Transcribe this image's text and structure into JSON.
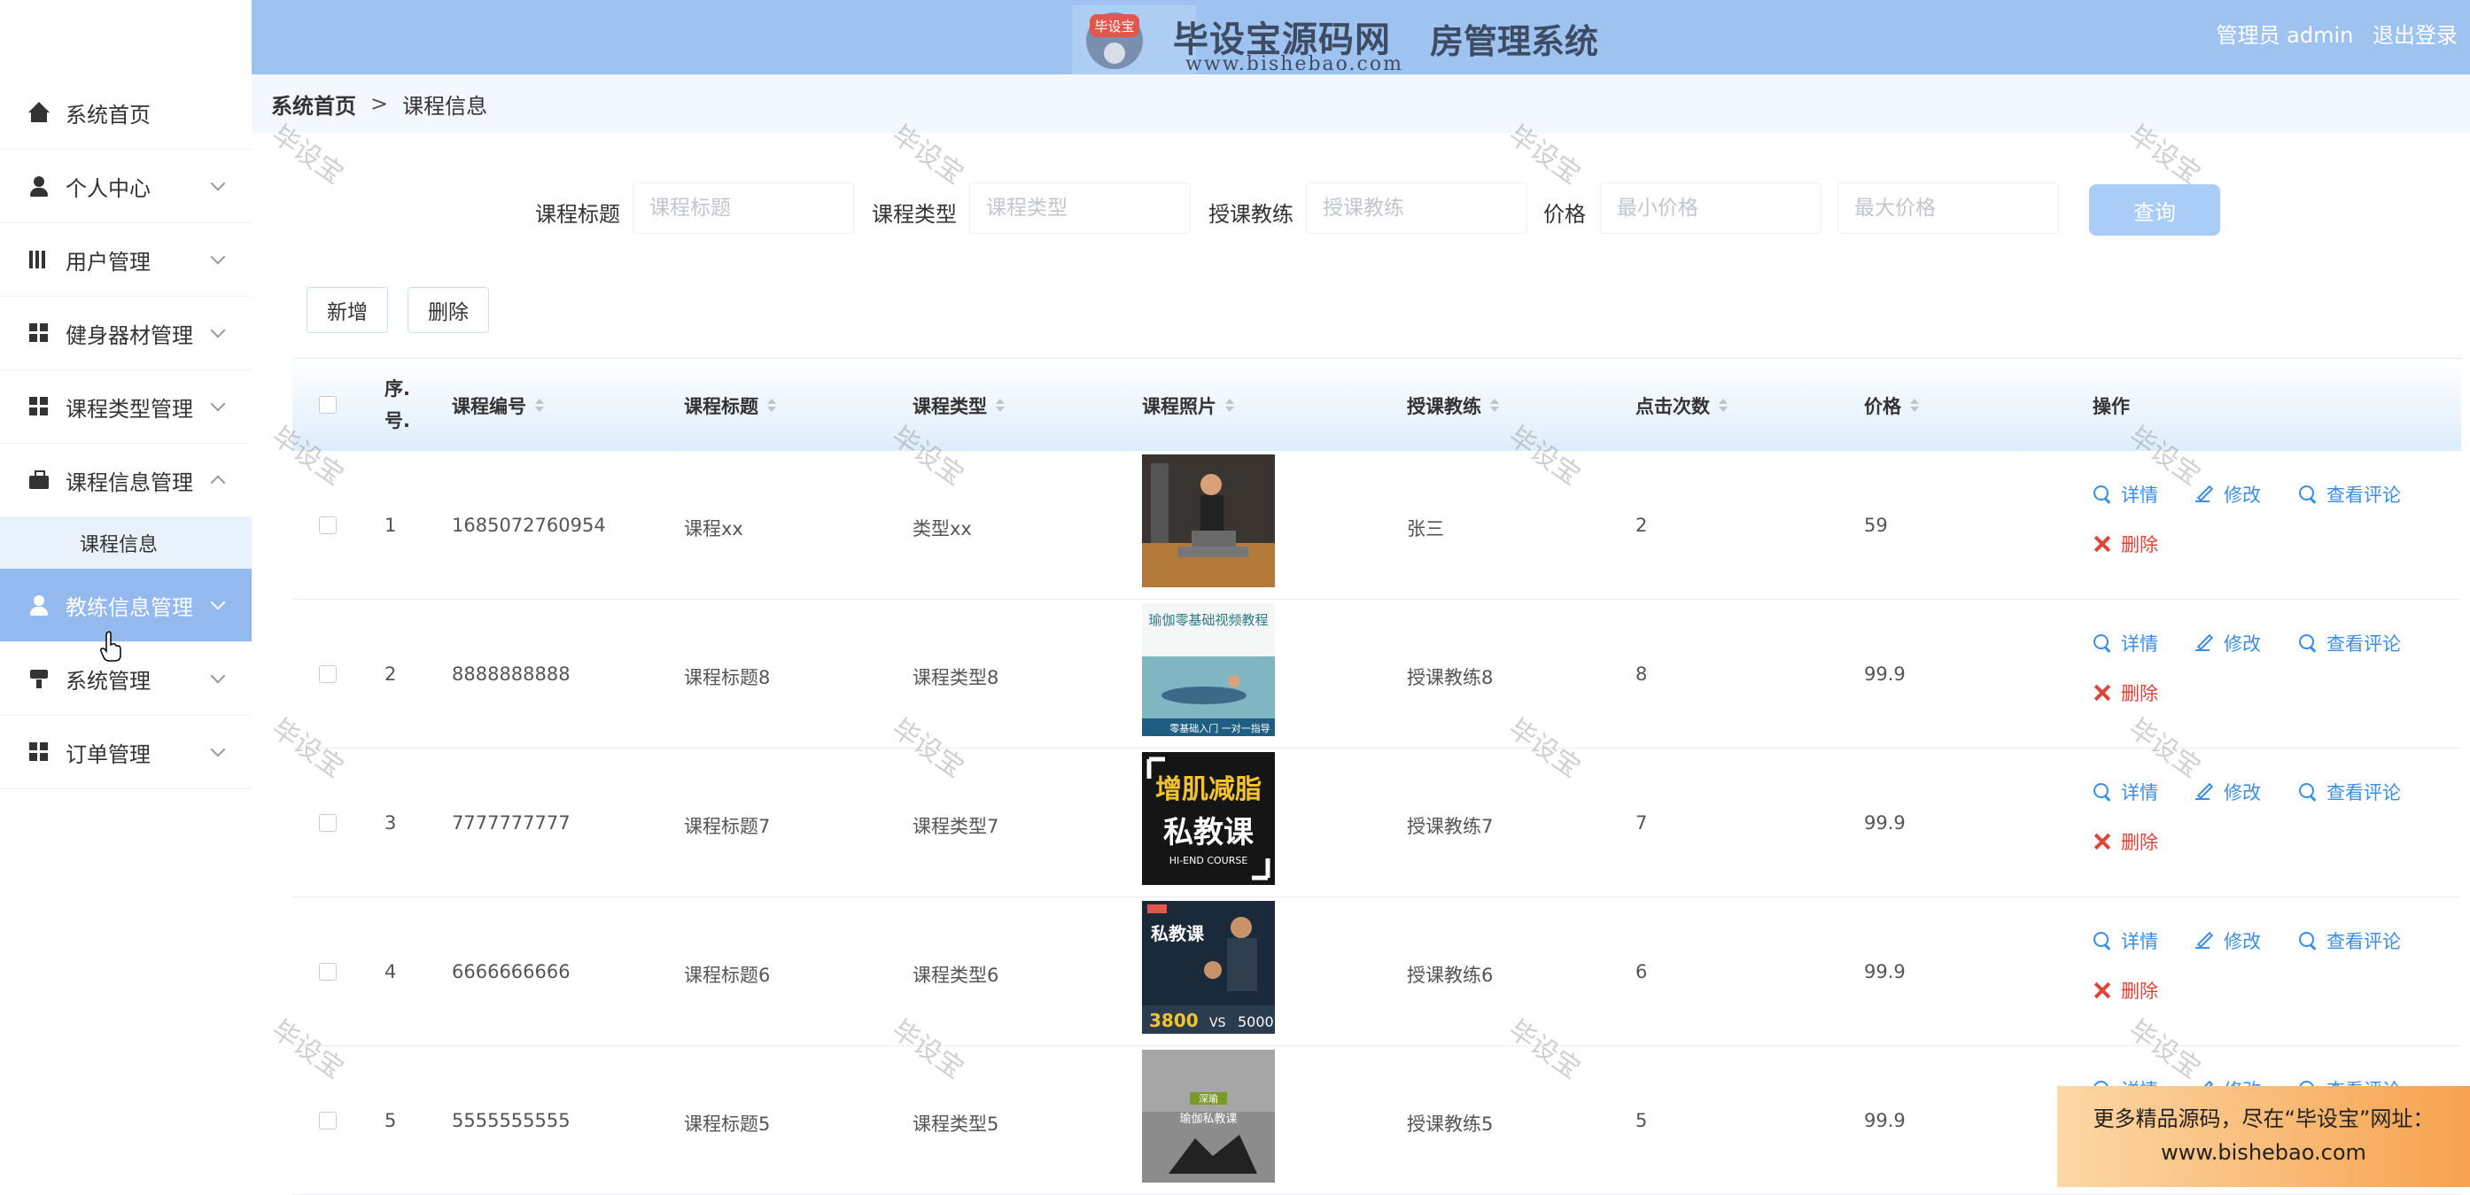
{
  "header": {
    "logo_badge": "毕设宝",
    "logo_title": "毕设宝源码网",
    "logo_sub": "www.bishebao.com",
    "system_title": "房管理系统",
    "user_label": "管理员 admin",
    "logout": "退出登录"
  },
  "sidebar": {
    "items": [
      {
        "label": "系统首页",
        "icon": "home-icon"
      },
      {
        "label": "个人中心",
        "icon": "user-icon"
      },
      {
        "label": "用户管理",
        "icon": "books-icon"
      },
      {
        "label": "健身器材管理",
        "icon": "grid-icon"
      },
      {
        "label": "课程类型管理",
        "icon": "grid-icon"
      },
      {
        "label": "课程信息管理",
        "icon": "bag-icon"
      },
      {
        "label": "教练信息管理",
        "icon": "user-icon"
      },
      {
        "label": "系统管理",
        "icon": "brush-icon"
      },
      {
        "label": "订单管理",
        "icon": "grid-icon"
      }
    ],
    "sub_item": "课程信息"
  },
  "breadcrumb": {
    "home": "系统首页",
    "sep": ">",
    "current": "课程信息"
  },
  "search": {
    "title_label": "课程标题",
    "title_placeholder": "课程标题",
    "type_label": "课程类型",
    "type_placeholder": "课程类型",
    "coach_label": "授课教练",
    "coach_placeholder": "授课教练",
    "price_label": "价格",
    "min_placeholder": "最小价格",
    "max_placeholder": "最大价格",
    "query_button": "查询"
  },
  "actions": {
    "add": "新增",
    "delete": "删除"
  },
  "table": {
    "headers": {
      "idx_line1": "序.",
      "idx_line2": "号.",
      "code": "课程编号",
      "title": "课程标题",
      "type": "课程类型",
      "photo": "课程照片",
      "coach": "授课教练",
      "clicks": "点击次数",
      "price": "价格",
      "ops": "操作"
    },
    "ops": {
      "detail": "详情",
      "edit": "修改",
      "comments": "查看评论",
      "delete": "删除"
    },
    "rows": [
      {
        "idx": "1",
        "code": "1685072760954",
        "title": "课程xx",
        "type": "类型xx",
        "coach": "张三",
        "clicks": "2",
        "price": "59"
      },
      {
        "idx": "2",
        "code": "8888888888",
        "title": "课程标题8",
        "type": "课程类型8",
        "coach": "授课教练8",
        "clicks": "8",
        "price": "99.9"
      },
      {
        "idx": "3",
        "code": "7777777777",
        "title": "课程标题7",
        "type": "课程类型7",
        "coach": "授课教练7",
        "clicks": "7",
        "price": "99.9"
      },
      {
        "idx": "4",
        "code": "6666666666",
        "title": "课程标题6",
        "type": "课程类型6",
        "coach": "授课教练6",
        "clicks": "6",
        "price": "99.9"
      },
      {
        "idx": "5",
        "code": "5555555555",
        "title": "课程标题5",
        "type": "课程类型5",
        "coach": "授课教练5",
        "clicks": "5",
        "price": "99.9"
      }
    ],
    "thumb_text": {
      "r2_title": "瑜伽零基础视频教程",
      "r2_bottom": "零基础入门 一对一指导",
      "r3_main": "增肌减脂",
      "r3_sub": "私教课",
      "r3_en": "HI-END COURSE",
      "r4_title": "私教课",
      "r4_num": "3800",
      "r4_vs": "VS",
      "r4_num2": "5000",
      "r5_badge": "深瑜",
      "r5_text": "瑜伽私教课"
    }
  },
  "watermark": "毕设宝",
  "promo": {
    "line1": "更多精品源码，尽在“毕设宝”网址：",
    "line2": "www.bishebao.com"
  },
  "colors": {
    "header": "#9fc3f1",
    "active_menu": "#93b9ee",
    "link": "#3a8ee6",
    "danger": "#e0433a"
  }
}
